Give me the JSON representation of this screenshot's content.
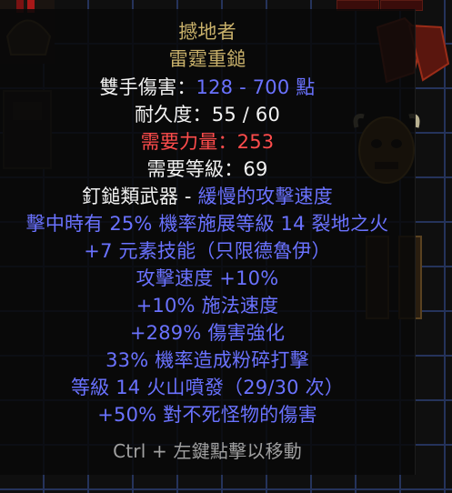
{
  "item": {
    "name": "撼地者",
    "base_type": "雷霆重鎚",
    "damage_label": "雙手傷害：",
    "damage_value": "128 - 700 點",
    "durability": "耐久度：55 / 60",
    "req_strength": "需要力量：253",
    "req_level": "需要等級：69",
    "weapon_class": "釘鎚類武器",
    "separator": " - ",
    "attack_speed_class": "緩慢的攻擊速度",
    "properties": [
      "擊中時有 25% 機率施展等級 14 裂地之火",
      "+7 元素技能（只限德魯伊）",
      "攻擊速度 +10%",
      "+10% 施法速度",
      "+289% 傷害強化",
      "33% 機率造成粉碎打擊",
      "等級 14 火山噴發（29/30 次）",
      "+50% 對不死怪物的傷害"
    ],
    "footer_hint": "Ctrl + 左鍵點擊以移動"
  },
  "colors": {
    "unique_gold": "#c8b06a",
    "magic_blue": "#6a72ff",
    "requirement_red": "#ff4c4c",
    "normal_white": "#f2f2f2",
    "hint_grey": "#a0a0a0"
  }
}
